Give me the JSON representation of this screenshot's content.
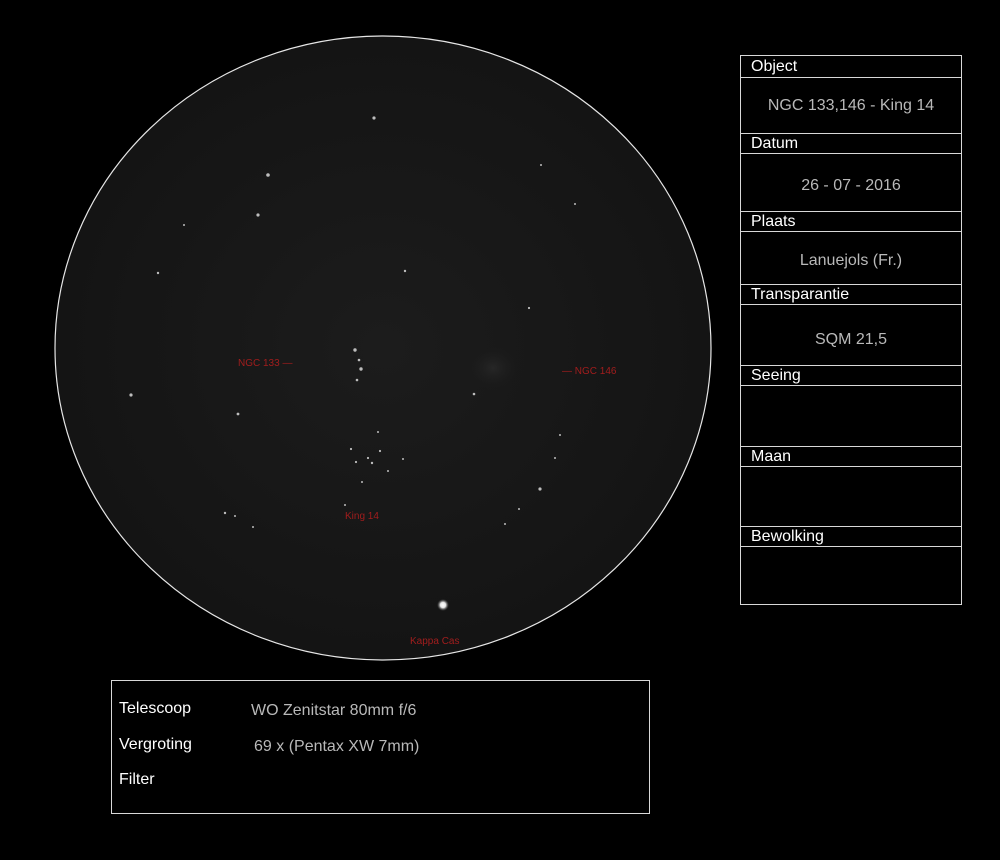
{
  "sketch": {
    "labels": {
      "ngc133": "NGC 133 —",
      "ngc146": "— NGC 146",
      "king14": "King 14",
      "kappa_cas": "Kappa Cas"
    }
  },
  "observation_log": {
    "fields": [
      {
        "label": "Object",
        "value": "NGC 133,146 - King 14"
      },
      {
        "label": "Datum",
        "value": "26 - 07 - 2016"
      },
      {
        "label": "Plaats",
        "value": "Lanuejols (Fr.)"
      },
      {
        "label": "Transparantie",
        "value": "SQM 21,5"
      },
      {
        "label": "Seeing",
        "value": ""
      },
      {
        "label": "Maan",
        "value": ""
      },
      {
        "label": "Bewolking",
        "value": ""
      }
    ]
  },
  "equipment": {
    "rows": [
      {
        "label": "Telescoop",
        "value": "WO Zenitstar 80mm f/6"
      },
      {
        "label": "Vergroting",
        "value": "69 x (Pentax XW 7mm)"
      },
      {
        "label": "Filter",
        "value": ""
      }
    ]
  }
}
